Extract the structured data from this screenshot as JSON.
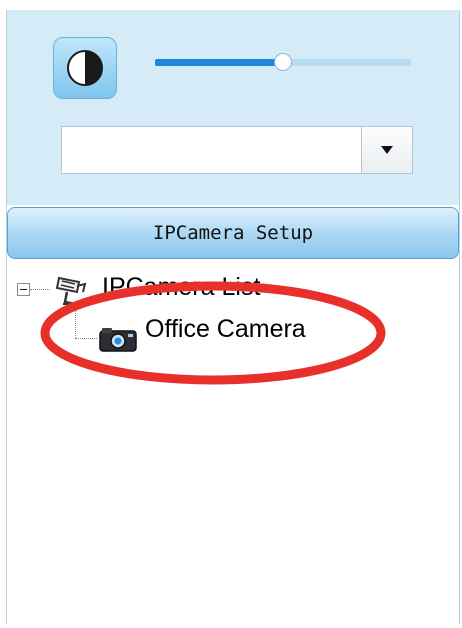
{
  "toolbar": {
    "contrast_icon": "contrast-icon",
    "brightness_slider": {
      "value_fraction": 0.5
    },
    "combo": {
      "value": "",
      "arrow_icon": "dropdown-arrow-icon"
    }
  },
  "setup_button": {
    "label": "IPCamera Setup"
  },
  "tree": {
    "root": {
      "label": "IPCamera List",
      "icon": "camera-list-icon",
      "expanded": true
    },
    "children": [
      {
        "label": "Office Camera",
        "icon": "ip-camera-icon"
      }
    ]
  },
  "colors": {
    "panel_bg": "#d6ebf8",
    "slider_fill": "#1e87d8",
    "highlight_ring": "#e8302b"
  }
}
